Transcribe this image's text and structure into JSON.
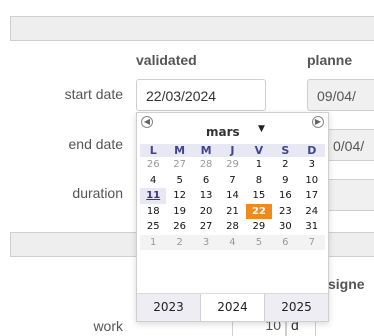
{
  "headers": {
    "validated": "validated",
    "planned": "planne",
    "assigned": "signe"
  },
  "rows": {
    "start_date_label": "start date",
    "end_date_label": "end date",
    "duration_label": "duration",
    "work_label": "work"
  },
  "fields": {
    "start_validated": "22/03/2024",
    "start_planned": "09/04/",
    "end_planned": "0/04/",
    "work_value": "10",
    "work_unit": "d"
  },
  "datepicker": {
    "month": "mars",
    "prev_icon": "circle-arrow-left-icon",
    "next_icon": "circle-arrow-right-icon",
    "dropdown_icon": "caret-down-icon",
    "weekdays": [
      "L",
      "M",
      "M",
      "J",
      "V",
      "S",
      "D"
    ],
    "weeks": [
      [
        {
          "d": "26",
          "o": true
        },
        {
          "d": "27",
          "o": true
        },
        {
          "d": "28",
          "o": true
        },
        {
          "d": "29",
          "o": true
        },
        {
          "d": "1"
        },
        {
          "d": "2"
        },
        {
          "d": "3"
        }
      ],
      [
        {
          "d": "4"
        },
        {
          "d": "5"
        },
        {
          "d": "6"
        },
        {
          "d": "7"
        },
        {
          "d": "8"
        },
        {
          "d": "9"
        },
        {
          "d": "10"
        }
      ],
      [
        {
          "d": "11",
          "today": true
        },
        {
          "d": "12"
        },
        {
          "d": "13"
        },
        {
          "d": "14"
        },
        {
          "d": "15"
        },
        {
          "d": "16"
        },
        {
          "d": "17"
        }
      ],
      [
        {
          "d": "18"
        },
        {
          "d": "19"
        },
        {
          "d": "20"
        },
        {
          "d": "21"
        },
        {
          "d": "22",
          "sel": true
        },
        {
          "d": "23"
        },
        {
          "d": "24"
        }
      ],
      [
        {
          "d": "25"
        },
        {
          "d": "26"
        },
        {
          "d": "27"
        },
        {
          "d": "28"
        },
        {
          "d": "29"
        },
        {
          "d": "30"
        },
        {
          "d": "31"
        }
      ],
      [
        {
          "d": "1",
          "o": true
        },
        {
          "d": "2",
          "o": true
        },
        {
          "d": "3",
          "o": true
        },
        {
          "d": "4",
          "o": true
        },
        {
          "d": "5",
          "o": true
        },
        {
          "d": "6",
          "o": true
        },
        {
          "d": "7",
          "o": true
        }
      ]
    ],
    "years": [
      "2023",
      "2024",
      "2025"
    ],
    "current_year": "2024",
    "selected_color": "#f08a1f"
  }
}
